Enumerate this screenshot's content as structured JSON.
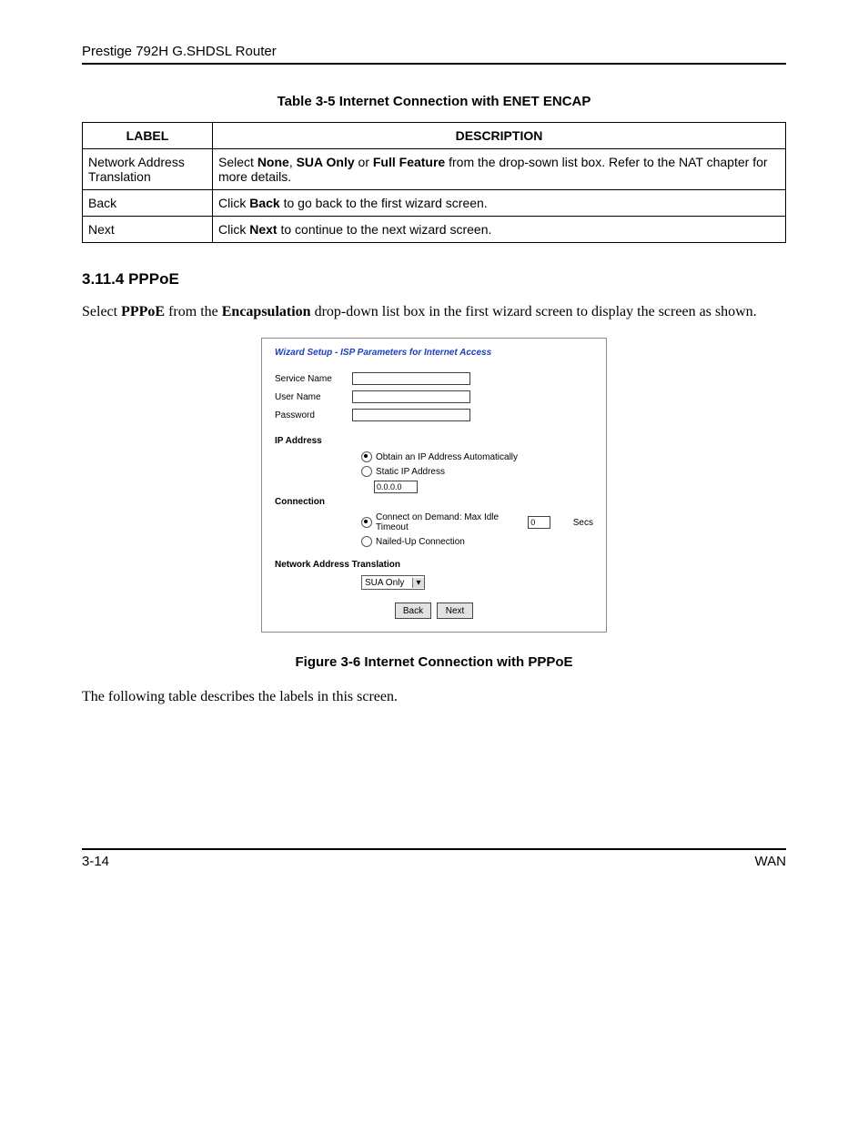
{
  "header": {
    "running_title": "Prestige 792H G.SHDSL Router"
  },
  "table": {
    "caption": "Table 3-5 Internet Connection with ENET ENCAP",
    "head": {
      "label": "LABEL",
      "description": "DESCRIPTION"
    },
    "rows": [
      {
        "label": "Network Address Translation",
        "desc_pre": "Select ",
        "desc_b1": "None",
        "desc_mid1": ", ",
        "desc_b2": "SUA Only",
        "desc_mid2": " or ",
        "desc_b3": "Full Feature",
        "desc_post": " from the drop-sown list box. Refer to the NAT chapter for more details."
      },
      {
        "label": "Back",
        "desc_pre": "Click ",
        "desc_b1": "Back",
        "desc_post": " to go back to the first wizard screen."
      },
      {
        "label": "Next",
        "desc_pre": "Click ",
        "desc_b1": "Next",
        "desc_post": " to continue to the next wizard screen."
      }
    ]
  },
  "section": {
    "number": "3.11.4",
    "title": "PPPoE",
    "para_pre": "Select ",
    "para_b1": "PPPoE",
    "para_mid1": " from the ",
    "para_b2": "Encapsulation",
    "para_post": " drop-down list box in the first wizard screen to display the screen as shown."
  },
  "wizard": {
    "title": "Wizard Setup - ISP Parameters for Internet Access",
    "service_name_label": "Service Name",
    "user_name_label": "User Name",
    "password_label": "Password",
    "ip_address_label": "IP Address",
    "ip_auto": "Obtain an IP Address Automatically",
    "ip_static": "Static IP Address",
    "ip_static_value": "0.0.0.0",
    "connection_label": "Connection",
    "conn_demand": "Connect on Demand: Max Idle Timeout",
    "conn_demand_val": "0",
    "conn_demand_unit": "Secs",
    "conn_nailed": "Nailed-Up Connection",
    "nat_label": "Network Address Translation",
    "nat_value": "SUA Only",
    "back_btn": "Back",
    "next_btn": "Next"
  },
  "figure_caption": "Figure 3-6 Internet Connection with PPPoE",
  "following_text": "The following table describes the labels in this screen.",
  "footer": {
    "page": "3-14",
    "section": "WAN"
  }
}
